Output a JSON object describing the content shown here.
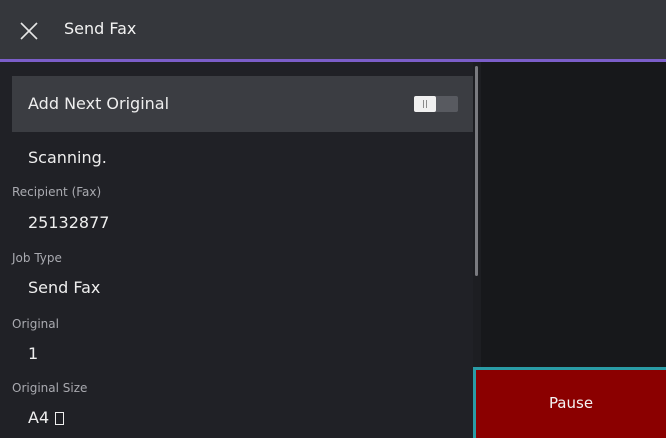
{
  "header": {
    "title": "Send Fax",
    "close_icon": "close-icon",
    "accent_color": "#7b5ec9"
  },
  "add_next_original": {
    "label": "Add Next Original",
    "toggle_on": false
  },
  "status": "Scanning.",
  "details": [
    {
      "label": "Recipient (Fax)",
      "value": "25132877"
    },
    {
      "label": "Job Type",
      "value": "Send Fax"
    },
    {
      "label": "Original",
      "value": "1"
    },
    {
      "label": "Original Size",
      "value": "A4",
      "icon": "portrait-page-icon"
    }
  ],
  "pause_button": {
    "label": "Pause",
    "color": "#8b0000",
    "focus_color": "#2a9ca6"
  }
}
